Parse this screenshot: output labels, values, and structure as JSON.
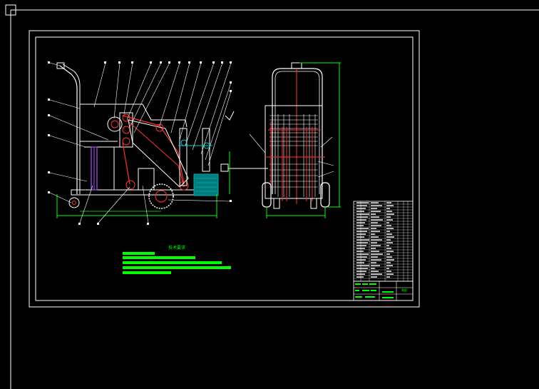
{
  "colors": {
    "background": "#000000",
    "frame": "#ffffff",
    "part_outline": "#ffffff",
    "belt": "#ff3333",
    "dimension": "#00ff00",
    "purple_column": "#b050ff",
    "water_tank": "#00b0b0",
    "leader": "#ffffff"
  },
  "notes": {
    "title": "技术要求"
  },
  "title_block": {
    "drawing_name": "装配"
  }
}
